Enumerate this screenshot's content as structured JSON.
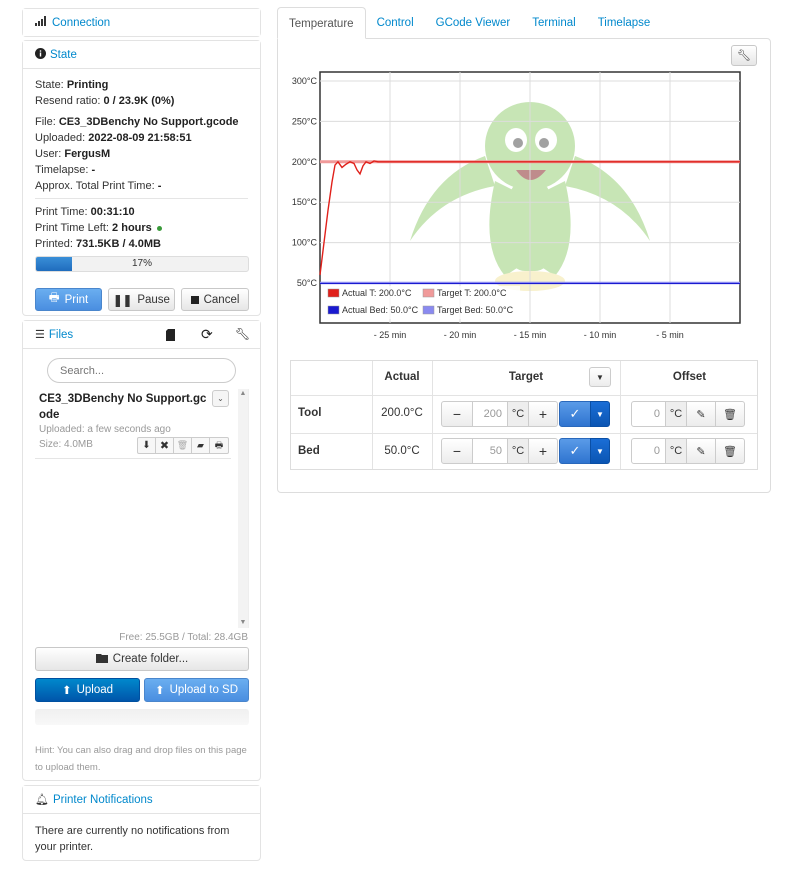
{
  "connection": {
    "title": "Connection"
  },
  "state": {
    "title": "State",
    "state_label": "State:",
    "state_value": "Printing",
    "resend_label": "Resend ratio:",
    "resend_value": "0 / 23.9K (0%)",
    "file_label": "File:",
    "file_value": "CE3_3DBenchy No Support.gcode",
    "uploaded_label": "Uploaded:",
    "uploaded_value": "2022-08-09 21:58:51",
    "user_label": "User:",
    "user_value": "FergusM",
    "timelapse_label": "Timelapse:",
    "timelapse_value": "-",
    "approx_label": "Approx. Total Print Time:",
    "approx_value": "-",
    "print_time_label": "Print Time:",
    "print_time_value": "00:31:10",
    "time_left_label": "Print Time Left:",
    "time_left_value": "2 hours",
    "printed_label": "Printed:",
    "printed_value": "731.5KB / 4.0MB",
    "progress_text": "17%",
    "progress_fraction": 0.17,
    "print_btn": "Print",
    "pause_btn": "Pause",
    "cancel_btn": "Cancel"
  },
  "files": {
    "title": "Files",
    "search_placeholder": "Search...",
    "item": {
      "name_line1": "CE3_3DBenchy No Support.gc",
      "name_line2": "ode",
      "uploaded": "Uploaded: a few seconds ago",
      "size": "Size: 4.0MB"
    },
    "storage": "Free: 25.5GB / Total: 28.4GB",
    "create_folder": "Create folder...",
    "upload": "Upload",
    "upload_sd": "Upload to SD",
    "hint_line1": "Hint: You can also drag and drop files on this page",
    "hint_line2": "to upload them."
  },
  "notifications": {
    "title": "Printer Notifications",
    "text_line1": "There are currently no notifications from",
    "text_line2": "your printer."
  },
  "tabs": [
    "Temperature",
    "Control",
    "GCode Viewer",
    "Terminal",
    "Timelapse"
  ],
  "chart_data": {
    "type": "line",
    "y_ticks": [
      "300°C",
      "250°C",
      "200°C",
      "150°C",
      "100°C",
      "50°C"
    ],
    "x_ticks": [
      "- 25 min",
      "- 20 min",
      "- 15 min",
      "- 10 min",
      "- 5 min"
    ],
    "legend": [
      "Actual T: 200.0°C",
      "Target T: 200.0°C",
      "Actual Bed: 50.0°C",
      "Target Bed: 50.0°C"
    ],
    "colors": {
      "actual_t": "#e0201a",
      "target_t": "#f09a9a",
      "actual_bed": "#1a1ad0",
      "target_bed": "#8a8af0"
    }
  },
  "temp_table": {
    "headers": {
      "actual": "Actual",
      "target": "Target",
      "offset": "Offset"
    },
    "tool": {
      "label": "Tool",
      "actual": "200.0°C",
      "target": "200",
      "offset": "0"
    },
    "bed": {
      "label": "Bed",
      "actual": "50.0°C",
      "target": "50",
      "offset": "0"
    },
    "unit": "°C"
  }
}
